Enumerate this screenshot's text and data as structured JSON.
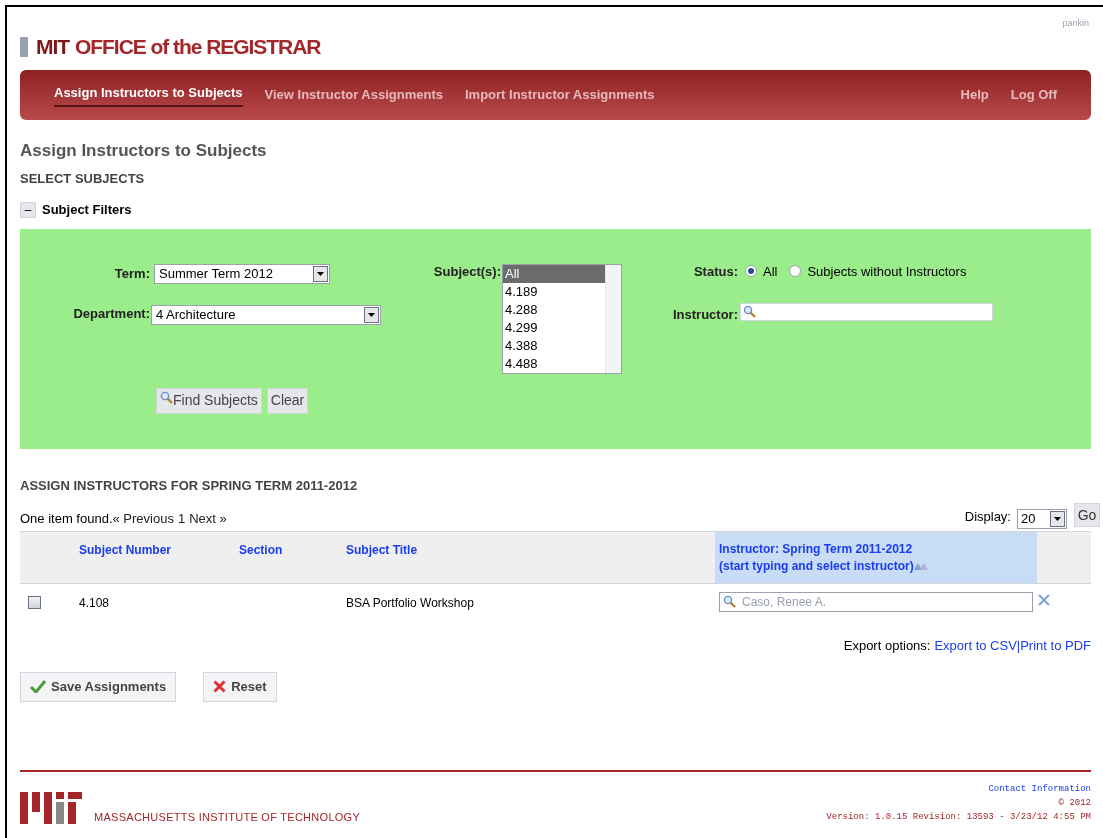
{
  "user": "pankin",
  "logo": {
    "part_1": "MIT",
    "part_2": "OFFICE of the REGISTRAR"
  },
  "nav": [
    {
      "label": "Assign Instructors to Subjects",
      "selected": true
    },
    {
      "label": "View Instructor Assignments",
      "selected": false
    },
    {
      "label": "Import Instructor Assignments",
      "selected": false
    }
  ],
  "nav_right": [
    "Help",
    "Log Off"
  ],
  "page_title": "Assign Instructors to Subjects",
  "select_heading": "SELECT SUBJECTS",
  "filters": {
    "toggle": "–",
    "title": "Subject Filters",
    "expanded": true,
    "term": {
      "label": "Term:",
      "value": "Summer Term 2012"
    },
    "department": {
      "label": "Department:",
      "value": "4 Architecture"
    },
    "subjects": {
      "label": "Subject(s):",
      "options": [
        {
          "label": "All",
          "selected": true
        },
        {
          "label": "4.189",
          "selected": false
        },
        {
          "label": "4.288",
          "selected": false
        },
        {
          "label": "4.299",
          "selected": false
        },
        {
          "label": "4.388",
          "selected": false
        },
        {
          "label": "4.488",
          "selected": false
        }
      ]
    },
    "status": {
      "label": "Status:",
      "options": [
        {
          "label": "All",
          "selected": true
        },
        {
          "label": "Subjects without Instructors",
          "selected": false
        }
      ]
    },
    "instructor": {
      "label": "Instructor:"
    },
    "buttons": [
      "Find Subjects",
      "Clear"
    ]
  },
  "assign": {
    "heading": "ASSIGN INSTRUCTORS FOR SPRING TERM 2011-2012",
    "summary": "One item found.",
    "pager": [
      "« Previous",
      "1",
      "Next »"
    ],
    "display": {
      "label": "Display:",
      "value": "20"
    },
    "go": "Go",
    "columns": [
      "Subject Number",
      "Section",
      "Subject Title",
      "Instructor: Spring Term 2011-2012",
      "(start typing and select instructor)"
    ],
    "rows": [
      {
        "checked": false,
        "subject_number": "4.108",
        "title": "BSA Portfolio Workshop",
        "instructor": "Caso, Renee A."
      }
    ],
    "export": {
      "label": "Export options:",
      "links": [
        "Export to CSV|",
        "Print to PDF"
      ]
    }
  },
  "actions": [
    {
      "kind": "save",
      "label": "Save Assignments"
    },
    {
      "kind": "reset",
      "label": "Reset"
    }
  ],
  "footer": {
    "institute": "MASSACHUSETTS INSTITUTE OF TECHNOLOGY",
    "contact": "Contact Information",
    "copyright": "© 2012",
    "version": "Version: 1.0.15 Revision: 13593 - 3/23/12 4:55 PM"
  }
}
